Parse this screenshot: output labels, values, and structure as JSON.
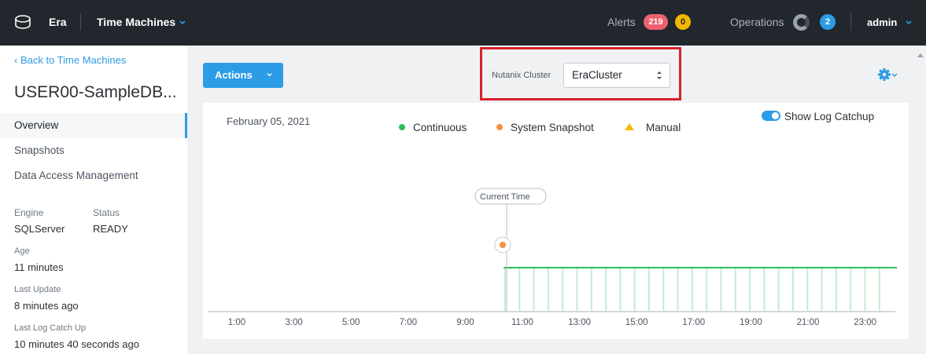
{
  "topbar": {
    "app_name": "Era",
    "section": "Time Machines",
    "alerts_label": "Alerts",
    "alerts_critical": "219",
    "alerts_warning": "0",
    "operations_label": "Operations",
    "operations_count": "2",
    "user": "admin"
  },
  "sidebar": {
    "back_link": "Back to Time Machines",
    "title": "USER00-SampleDB...",
    "nav": [
      {
        "label": "Overview"
      },
      {
        "label": "Snapshots"
      },
      {
        "label": "Data Access Management"
      }
    ],
    "engine_label": "Engine",
    "engine_value": "SQLServer",
    "status_label": "Status",
    "status_value": "READY",
    "age_label": "Age",
    "age_value": "11 minutes",
    "last_update_label": "Last Update",
    "last_update_value": "8 minutes ago",
    "last_log_label": "Last Log Catch Up",
    "last_log_value": "10 minutes 40 seconds ago"
  },
  "toolbar": {
    "actions_label": "Actions",
    "cluster_label": "Nutanix Cluster",
    "cluster_value": "EraCluster"
  },
  "timeline": {
    "date": "February 05, 2021",
    "legend": [
      {
        "label": "Continuous",
        "color": "#2ebd59"
      },
      {
        "label": "System Snapshot",
        "color": "#f5913e"
      },
      {
        "label": "Manual",
        "color": "#f5b800"
      }
    ],
    "show_log_catchup_label": "Show Log Catchup",
    "show_log_catchup_on": true,
    "current_time_label": "Current Time",
    "ticks": [
      "1:00",
      "3:00",
      "5:00",
      "7:00",
      "9:00",
      "11:00",
      "13:00",
      "15:00",
      "17:00",
      "19:00",
      "21:00",
      "23:00"
    ]
  }
}
